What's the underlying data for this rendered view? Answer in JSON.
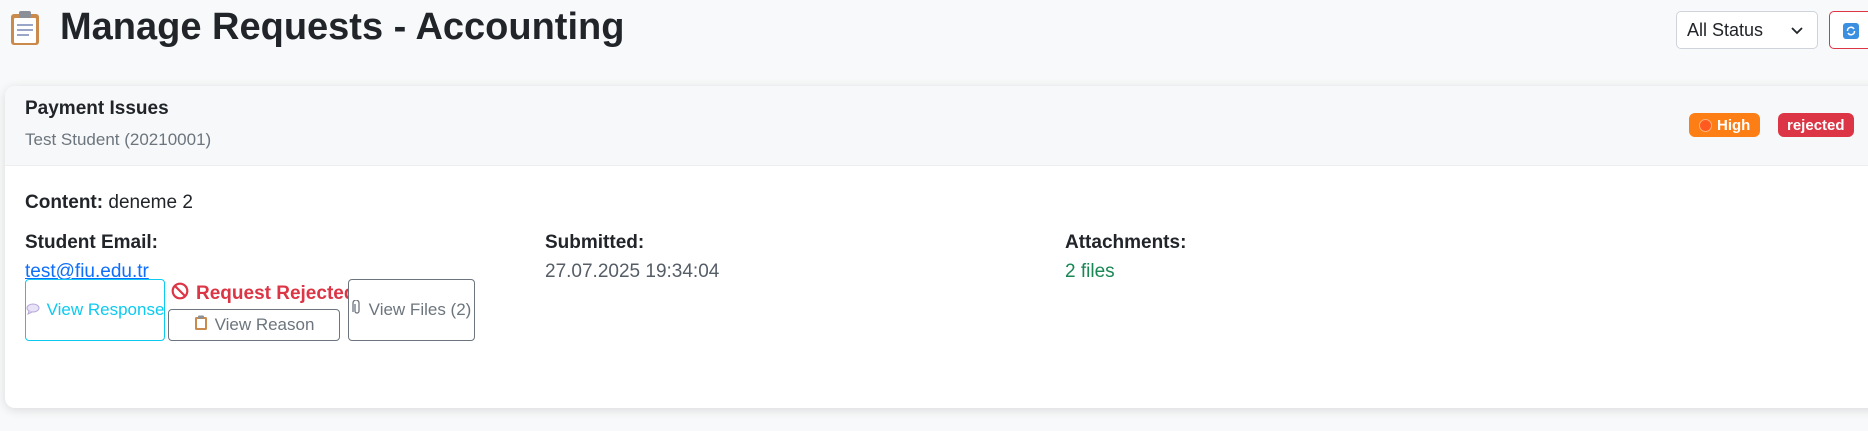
{
  "header": {
    "title": "Manage Requests - Accounting",
    "title_icon": "clipboard-icon",
    "status_filter": {
      "selected": "All Status"
    },
    "refresh_icon": "refresh-icon"
  },
  "request": {
    "title": "Payment Issues",
    "student": "Test Student (20210001)",
    "priority": "High",
    "status": "rejected",
    "content_label": "Content:",
    "content": "deneme 2",
    "email_label": "Student Email:",
    "email": "test@fiu.edu.tr",
    "submitted_label": "Submitted:",
    "submitted": "27.07.2025 19:34:04",
    "attachments_label": "Attachments:",
    "attachments": "2 files",
    "actions": {
      "view_response": "View Response",
      "rejected_label": "Request Rejected",
      "view_reason": "View Reason",
      "view_files": "View Files (2)"
    }
  },
  "colors": {
    "priority_high": "#fd7e14",
    "status_rejected": "#dc3545",
    "info": "#0dcaf0",
    "link": "#0d6efd",
    "files": "#198754"
  }
}
